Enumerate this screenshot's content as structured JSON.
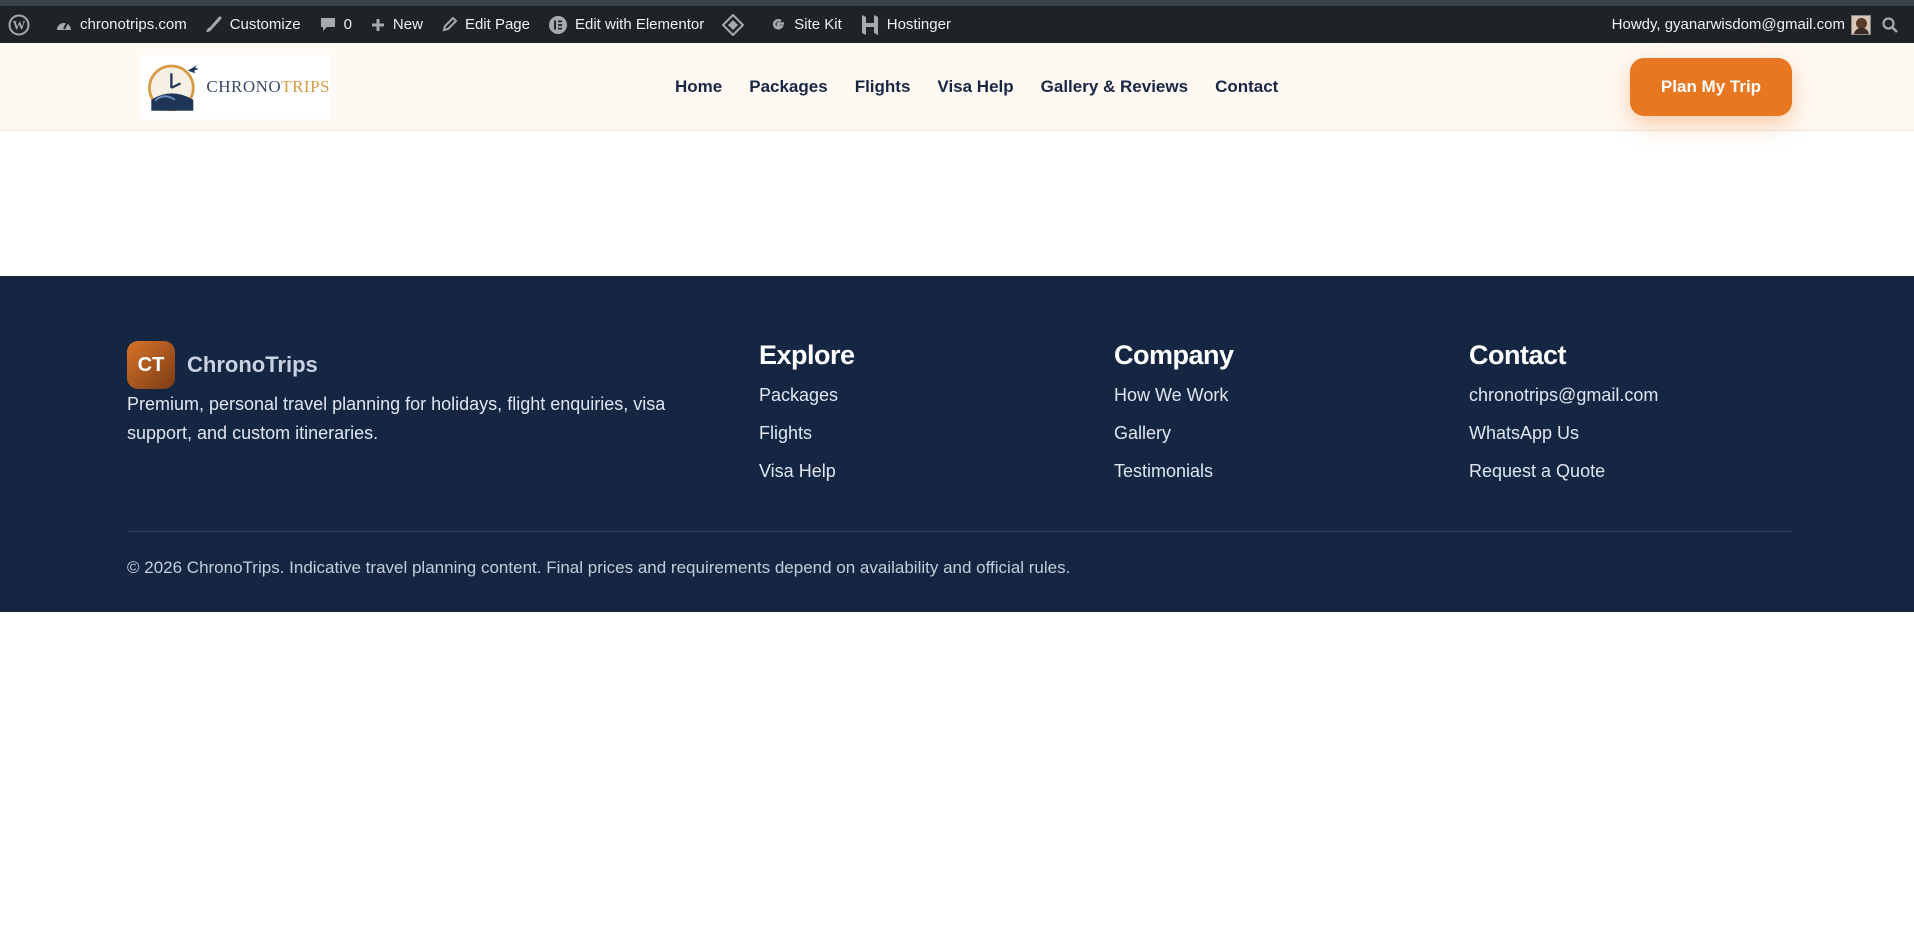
{
  "admin_bar": {
    "site_name": "chronotrips.com",
    "customize": "Customize",
    "comments_count": "0",
    "new_label": "New",
    "edit_page": "Edit Page",
    "edit_elementor": "Edit with Elementor",
    "site_kit": "Site Kit",
    "hostinger": "Hostinger",
    "howdy": "Howdy, gyanarwisdom@gmail.com"
  },
  "header": {
    "logo_text_a": "CHRONO",
    "logo_text_b": "TRIPS",
    "nav": [
      "Home",
      "Packages",
      "Flights",
      "Visa Help",
      "Gallery & Reviews",
      "Contact"
    ],
    "cta_label": "Plan My Trip"
  },
  "footer": {
    "badge": "CT",
    "brand_name": "ChronoTrips",
    "tagline": "Premium, personal travel planning for holidays, flight enquiries, visa support, and custom itineraries.",
    "columns": [
      {
        "title": "Explore",
        "links": [
          "Packages",
          "Flights",
          "Visa Help"
        ]
      },
      {
        "title": "Company",
        "links": [
          "How We Work",
          "Gallery",
          "Testimonials"
        ]
      },
      {
        "title": "Contact",
        "links": [
          "chronotrips@gmail.com",
          "WhatsApp Us",
          "Request a Quote"
        ]
      }
    ],
    "copyright": "© 2026 ChronoTrips. Indicative travel planning content. Final prices and requirements depend on availability and official rules."
  },
  "colors": {
    "admin_bar_bg": "#1d2327",
    "header_bg": "#fff9f3",
    "accent": "#e87722",
    "nav_text": "#1a2744",
    "footer_bg": "#152642"
  }
}
